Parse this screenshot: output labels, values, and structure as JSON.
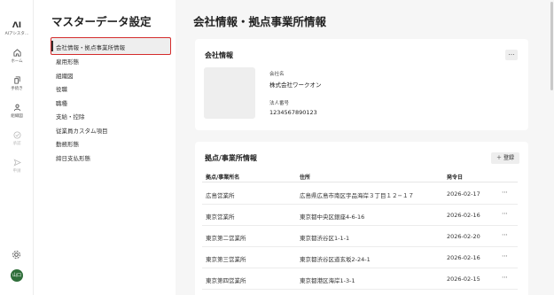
{
  "rail": {
    "logo_glyph": "ΛI",
    "logo_caption": "AIアシスタ…",
    "items": [
      {
        "icon": "home-icon",
        "label": "ホーム",
        "muted": false
      },
      {
        "icon": "procedure-icon",
        "label": "手続き",
        "muted": false
      },
      {
        "icon": "organization-icon",
        "label": "組織図",
        "muted": false
      },
      {
        "icon": "approval-icon",
        "label": "承認",
        "muted": true
      },
      {
        "icon": "send-icon",
        "label": "申請",
        "muted": true
      }
    ],
    "avatar_text": "山口"
  },
  "sidebar": {
    "title": "マスターデータ設定",
    "items": [
      "会社情報・拠点事業所情報",
      "雇用形態",
      "組織図",
      "役職",
      "職種",
      "支給・控除",
      "従業員カスタム項目",
      "勤務形態",
      "締日支払形態"
    ],
    "active_index": 0
  },
  "main": {
    "title": "会社情報・拠点事業所情報",
    "company": {
      "title": "会社情報",
      "more": "…",
      "name_label": "会社名",
      "name_value": "株式会社ワークオン",
      "number_label": "法人番号",
      "number_value": "1234567890123"
    },
    "offices": {
      "title": "拠点/事業所情報",
      "register_label": "＋ 登録",
      "columns": [
        "拠点/事業所名",
        "住所",
        "発令日"
      ],
      "rows": [
        {
          "name": "広島営業所",
          "address": "広島県広島市南区宇品海岸３丁目１２−１７",
          "date": "2026-02-17"
        },
        {
          "name": "東京営業所",
          "address": "東京都中央区銀座4-6-16",
          "date": "2026-02-16"
        },
        {
          "name": "東京第二営業所",
          "address": "東京都渋谷区1-1-1",
          "date": "2026-02-20"
        },
        {
          "name": "東京第三営業所",
          "address": "東京都渋谷区道玄坂2-24-1",
          "date": "2026-02-16"
        },
        {
          "name": "東京第四営業所",
          "address": "東京都港区海岸1-3-1",
          "date": "2026-02-15"
        }
      ],
      "row_more": "⋯"
    }
  }
}
